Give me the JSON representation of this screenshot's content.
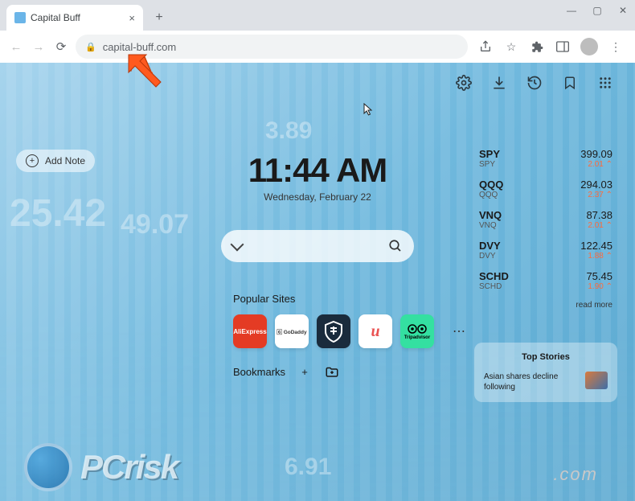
{
  "browser": {
    "tab_title": "Capital Buff",
    "url": "capital-buff.com"
  },
  "add_note_label": "Add Note",
  "clock_time": "11:44 AM",
  "clock_date": "Wednesday, February 22",
  "popular_sites": {
    "heading": "Popular Sites",
    "tiles": [
      {
        "name": "AliExpress",
        "label": "AliExpress"
      },
      {
        "name": "GoDaddy",
        "label": "GoDaddy"
      },
      {
        "name": "USAA",
        "label": ""
      },
      {
        "name": "Udemy",
        "label": "u"
      },
      {
        "name": "Tripadvisor",
        "label": "Tripadvisor"
      }
    ]
  },
  "bookmarks_label": "Bookmarks",
  "tickers": [
    {
      "sym": "SPY",
      "sub": "SPY",
      "price": "399.09",
      "delta": "2.01 ⌃"
    },
    {
      "sym": "QQQ",
      "sub": "QQQ",
      "price": "294.03",
      "delta": "2.37 ⌃"
    },
    {
      "sym": "VNQ",
      "sub": "VNQ",
      "price": "87.38",
      "delta": "2.01 ⌃"
    },
    {
      "sym": "DVY",
      "sub": "DVY",
      "price": "122.45",
      "delta": "1.88 ⌃"
    },
    {
      "sym": "SCHD",
      "sub": "SCHD",
      "price": "75.45",
      "delta": "1.90 ⌃"
    }
  ],
  "read_more_label": "read more",
  "top_stories": {
    "heading": "Top Stories",
    "headline": "Asian shares decline following"
  },
  "bg_numbers": [
    "3.89",
    "25.42",
    "49.07",
    "6.91"
  ],
  "watermark": {
    "text": "PCrisk",
    "sub": ".com"
  }
}
